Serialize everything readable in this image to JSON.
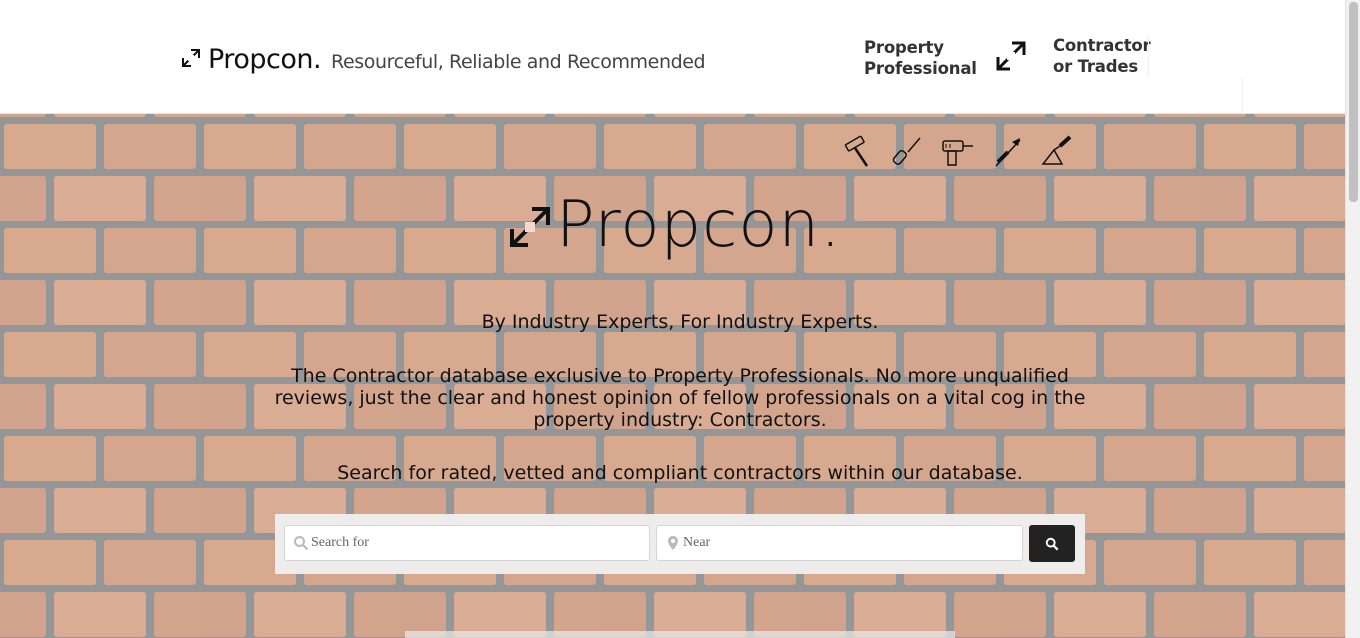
{
  "header": {
    "brand_name": "Propcon.",
    "tagline": "Resourceful, Reliable and Recommended",
    "nav_property": [
      "Property",
      "Professional"
    ],
    "nav_contractor": [
      "Contractor",
      "or Trades"
    ]
  },
  "hero": {
    "logo_text": "Propcon.",
    "tagline": "By Industry Experts, For Industry Experts.",
    "description": "The Contractor database exclusive to Property Professionals. No more unqualified reviews, just the clear and honest opinion of fellow professionals on a vital cog in the property industry: Contractors.",
    "search_prompt": "Search for rated, vetted and compliant contractors within our database.",
    "tools": [
      "hammer-icon",
      "screwdriver-icon",
      "drill-icon",
      "chisel-icon",
      "trowel-icon"
    ]
  },
  "search": {
    "what_placeholder": "Search for",
    "where_placeholder": "Near",
    "what_value": "",
    "where_value": ""
  },
  "colors": {
    "brick": "#c47a56",
    "mortar": "#5d6166",
    "button": "#222222",
    "text": "#111111"
  }
}
